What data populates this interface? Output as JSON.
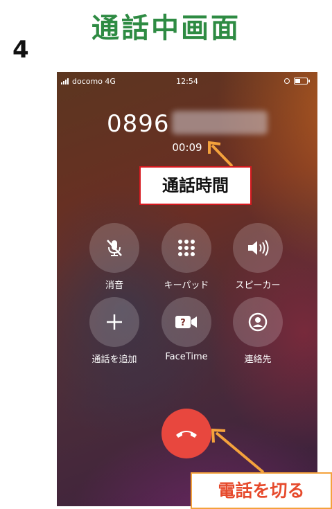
{
  "slide": {
    "title": "通話中画面",
    "step_number": "4"
  },
  "status_bar": {
    "carrier": "docomo  4G",
    "time": "12:54"
  },
  "call": {
    "number": "0896",
    "duration": "00:09"
  },
  "controls": [
    {
      "label": "消音",
      "icon": "mic-muted-icon"
    },
    {
      "label": "キーパッド",
      "icon": "keypad-icon"
    },
    {
      "label": "スピーカー",
      "icon": "speaker-icon"
    },
    {
      "label": "通話を追加",
      "icon": "plus-icon"
    },
    {
      "label": "FaceTime",
      "icon": "facetime-icon"
    },
    {
      "label": "連絡先",
      "icon": "contact-icon"
    }
  ],
  "annotations": {
    "call_duration": "通話時間",
    "end_call": "電話を切る"
  },
  "colors": {
    "title": "#2e8b43",
    "end_call": "#e8473e",
    "annotation_orange": "#f4a23c",
    "annotation_border_red": "#d7191f"
  }
}
